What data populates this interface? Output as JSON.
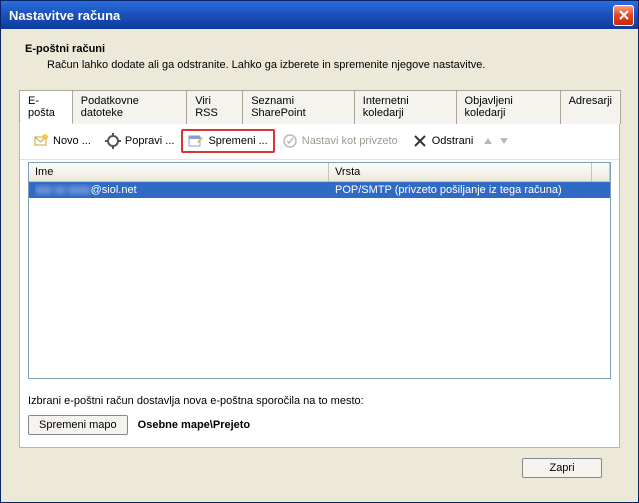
{
  "window": {
    "title": "Nastavitve računa"
  },
  "header": {
    "heading": "E-poštni računi",
    "subheading": "Račun lahko dodate ali ga odstranite. Lahko ga izberete in spremenite njegove nastavitve."
  },
  "tabs": {
    "items": [
      {
        "label": "E-pošta",
        "active": true
      },
      {
        "label": "Podatkovne datoteke"
      },
      {
        "label": "Viri RSS"
      },
      {
        "label": "Seznami SharePoint"
      },
      {
        "label": "Internetni koledarji"
      },
      {
        "label": "Objavljeni koledarji"
      },
      {
        "label": "Adresarji"
      }
    ]
  },
  "toolbar": {
    "new_label": "Novo ...",
    "repair_label": "Popravi ...",
    "change_label": "Spremeni ...",
    "set_default_label": "Nastavi kot privzeto",
    "remove_label": "Odstrani"
  },
  "list": {
    "col_name": "Ime",
    "col_type": "Vrsta",
    "rows": [
      {
        "name_prefix_obscured": "xxx xx xxxx",
        "name_suffix": "@siol.net",
        "type": "POP/SMTP (privzeto pošiljanje iz tega računa)"
      }
    ]
  },
  "delivery": {
    "label": "Izbrani e-poštni račun dostavlja nova e-poštna sporočila na to mesto:",
    "change_folder_btn": "Spremeni mapo",
    "path": "Osebne mape\\Prejeto"
  },
  "footer": {
    "close_btn": "Zapri"
  }
}
